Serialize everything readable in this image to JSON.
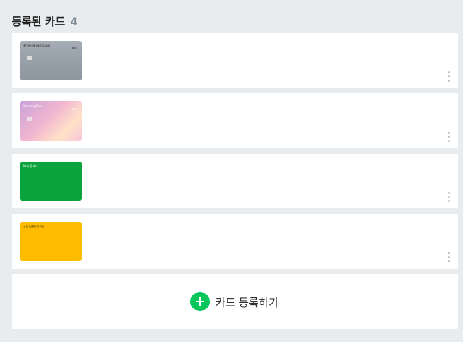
{
  "header": {
    "title": "등록된 카드",
    "count": "4"
  },
  "cards": [
    {
      "front_text": "SF SAMSUNG CARD",
      "brand": "TIKS",
      "color": "#9aa3ab"
    },
    {
      "front_text": "SamsungCard",
      "brand": "Lotte",
      "color": "#e6b8d6"
    },
    {
      "front_text": "NH농협카드",
      "brand": "",
      "color": "#0aa43c"
    },
    {
      "front_text": "국민 오프라인카드",
      "brand": "",
      "color": "#ffbc00"
    }
  ],
  "add_card": {
    "label": "카드 등록하기",
    "icon": "plus-icon"
  }
}
